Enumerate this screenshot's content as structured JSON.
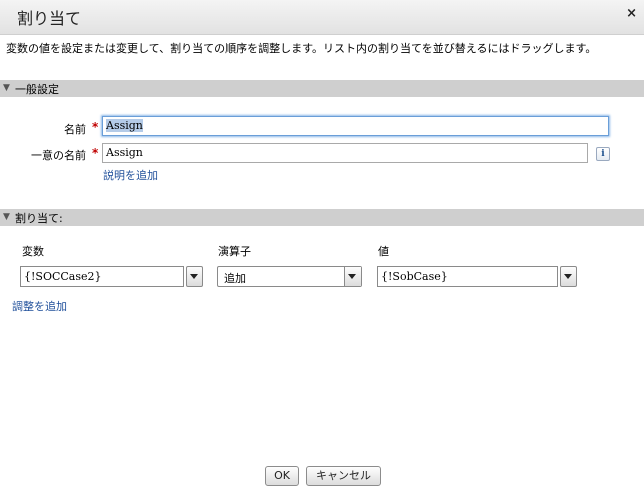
{
  "dialog": {
    "title": "割り当て",
    "close_glyph": "×",
    "description": "変数の値を設定または変更して、割り当ての順序を調整します。リスト内の割り当てを並び替えるにはドラッグします。"
  },
  "general_section": {
    "title": "一般設定",
    "name_label": "名前",
    "name_value": "Assign",
    "unique_name_label": "一意の名前",
    "unique_name_value": "Assign",
    "info_glyph": "i",
    "add_description_link": "説明を追加"
  },
  "assignment_section": {
    "title": "割り当て:",
    "headers": {
      "variable": "変数",
      "operator": "演算子",
      "value": "値"
    },
    "row": {
      "variable": "{!SOCCase2}",
      "operator": "追加",
      "value": "{!SobCase}"
    },
    "add_adjustment_link": "調整を追加"
  },
  "buttons": {
    "ok": "OK",
    "cancel": "キャンセル"
  },
  "colors": {
    "section_bar": "#cfcfcf",
    "link": "#1f4f9a",
    "required": "#c00000",
    "focus_border": "#6a9ed8"
  },
  "icons": [
    "close-icon",
    "collapse-triangle-icon",
    "info-icon",
    "chevron-down-icon"
  ]
}
